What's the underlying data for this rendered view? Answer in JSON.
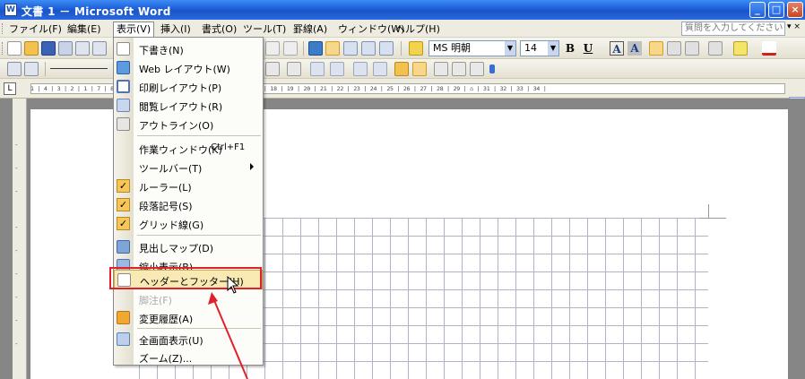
{
  "window": {
    "title": "文書 1 － Microsoft Word",
    "app_icon": "W",
    "controls": {
      "minimize": "_",
      "maximize": "□",
      "close": "×"
    }
  },
  "menubar": {
    "items": [
      {
        "label": "ファイル(F)"
      },
      {
        "label": "編集(E)"
      },
      {
        "label": "表示(V)",
        "open": true
      },
      {
        "label": "挿入(I)"
      },
      {
        "label": "書式(O)"
      },
      {
        "label": "ツール(T)"
      },
      {
        "label": "罫線(A)"
      },
      {
        "label": "ウィンドウ(W)"
      },
      {
        "label": "ヘルプ(H)"
      }
    ],
    "help_placeholder": "質問を入力してください",
    "help_close": "▾ ×"
  },
  "toolbar": {
    "font_name": "MS 明朝",
    "font_size": "14",
    "bold": "B",
    "underline": "U",
    "char_border": "A",
    "char_shading": "A"
  },
  "ruler": {
    "corner_symbol": "L",
    "numbers": "1 | 4 | 3 | 2 | 1 |           7 | 8 | 9 | 10 | 11 | 12 | 13 | 14 | 15 | 16 | 17 | 18 | 19 | 20 | 21 | 22 | 23 | 24 | 25 | 26 | 27 | 28 | 29 | ⌂ | 31 | 32 | 33 | 34 |"
  },
  "view_menu": {
    "items": [
      {
        "label": "下書き(N)",
        "icon": "draft-view-icon",
        "type": "icon"
      },
      {
        "label": "Web レイアウト(W)",
        "icon": "web-layout-icon",
        "type": "icon"
      },
      {
        "label": "印刷レイアウト(P)",
        "icon": "print-layout-icon",
        "type": "icon"
      },
      {
        "label": "閲覧レイアウト(R)",
        "icon": "reading-layout-icon",
        "type": "icon"
      },
      {
        "label": "アウトライン(O)",
        "icon": "outline-view-icon",
        "type": "icon"
      },
      {
        "label": "作業ウィンドウ(K)",
        "shortcut": "Ctrl+F1",
        "type": "plain"
      },
      {
        "label": "ツールバー(T)",
        "submenu": true,
        "type": "plain"
      },
      {
        "label": "ルーラー(L)",
        "checked": true,
        "type": "check"
      },
      {
        "label": "段落記号(S)",
        "checked": true,
        "type": "check"
      },
      {
        "label": "グリッド線(G)",
        "checked": true,
        "type": "check"
      },
      {
        "label": "見出しマップ(D)",
        "icon": "document-map-icon",
        "type": "icon"
      },
      {
        "label": "縮小表示(B)",
        "icon": "thumbnails-icon",
        "type": "icon"
      },
      {
        "label": "ヘッダーとフッター(H)",
        "icon": "header-footer-icon",
        "type": "icon",
        "highlighted": true
      },
      {
        "label": "脚注(F)",
        "disabled": true,
        "type": "plain"
      },
      {
        "label": "変更履歴(A)",
        "icon": "markup-icon",
        "type": "icon"
      },
      {
        "label": "全画面表示(U)",
        "icon": "full-screen-icon",
        "type": "icon"
      },
      {
        "label": "ズーム(Z)...",
        "type": "plain"
      }
    ]
  },
  "colors": {
    "titlebar": "#1c5fd8",
    "highlight": "#f9e9b3",
    "annotation_red": "#e0202a",
    "check_bg": "#f7c656"
  }
}
